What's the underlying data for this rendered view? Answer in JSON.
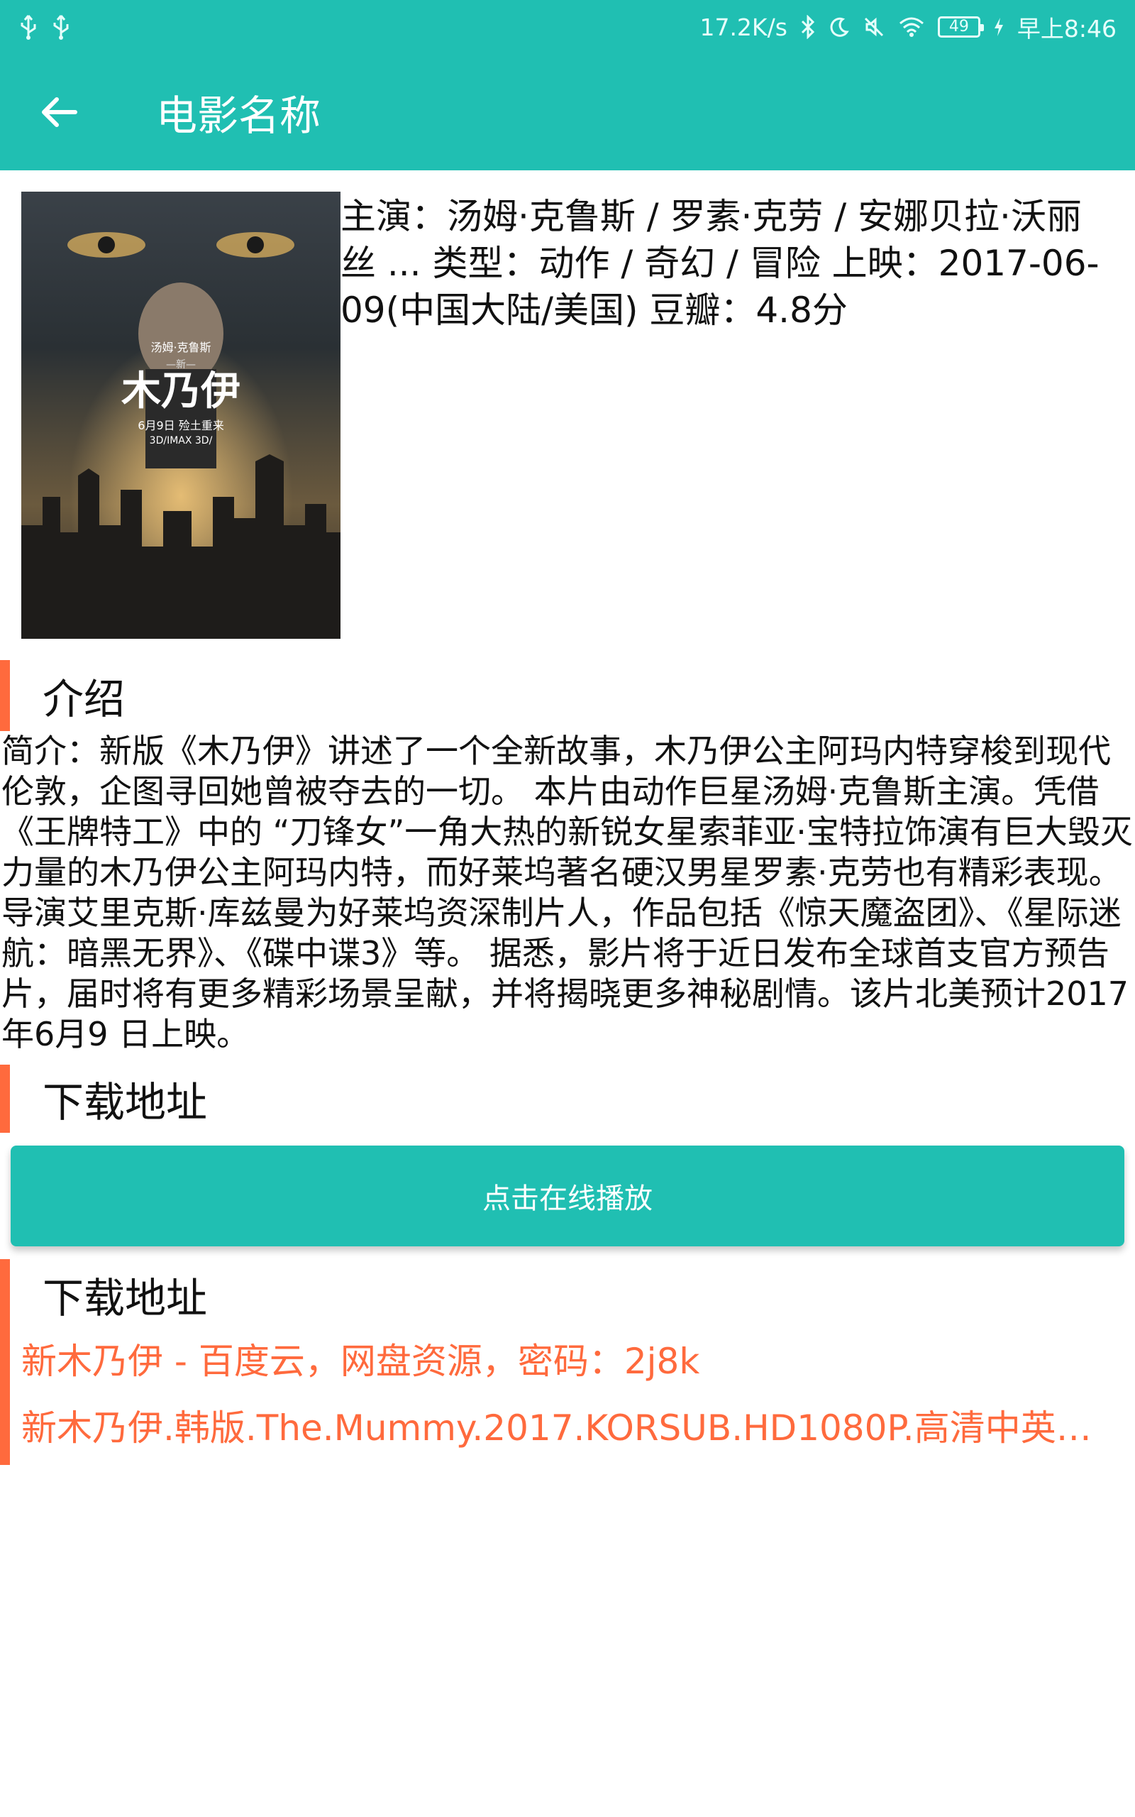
{
  "status_bar": {
    "left_icons": [
      "usb-icon",
      "usb-icon"
    ],
    "net_speed": "17.2K/s",
    "battery": "49",
    "time": "早上8:46"
  },
  "app_bar": {
    "title": "电影名称"
  },
  "movie": {
    "details": "主演：汤姆·克鲁斯 / 罗素·克劳 / 安娜贝拉·沃丽丝 ... 类型：动作 / 奇幻 / 冒险 上映：2017-06-09(中国大陆/美国) 豆瓣：4.8分",
    "poster": {
      "actor_text": "汤姆·克鲁斯",
      "prefix_text": "—新—",
      "title_text": "木乃伊",
      "release_text": "6月9日 殓土重来",
      "format_text": "3D/IMAX 3D/"
    }
  },
  "intro": {
    "title": "介绍",
    "body": "简介：新版《木乃伊》讲述了一个全新故事，木乃伊公主阿玛内特穿梭到现代伦敦，企图寻回她曾被夺去的一切。 本片由动作巨星汤姆·克鲁斯主演。凭借《王牌特工》中的 “刀锋女”一角大热的新锐女星索菲亚·宝特拉饰演有巨大毁灭力量的木乃伊公主阿玛内特，而好莱坞著名硬汉男星罗素·克劳也有精彩表现。 导演艾里克斯·库兹曼为好莱坞资深制片人，作品包括《惊天魔盗团》、《星际迷航：暗黑无界》、《碟中谍3》等。 据悉，影片将于近日发布全球首支官方预告片，届时将有更多精彩场景呈献，并将揭晓更多神秘剧情。该片北美预计2017年6月9 日上映。"
  },
  "download": {
    "title": "下载地址",
    "play_label": "点击在线播放",
    "title2": "下载地址",
    "links": [
      "新木乃伊 - 百度云，网盘资源，密码：2j8k",
      "新木乃伊.韩版.The.Mummy.2017.KORSUB.HD1080P.高清中英字幕…"
    ]
  },
  "colors": {
    "primary": "#20bfb2",
    "accent": "#ff6a3d"
  }
}
